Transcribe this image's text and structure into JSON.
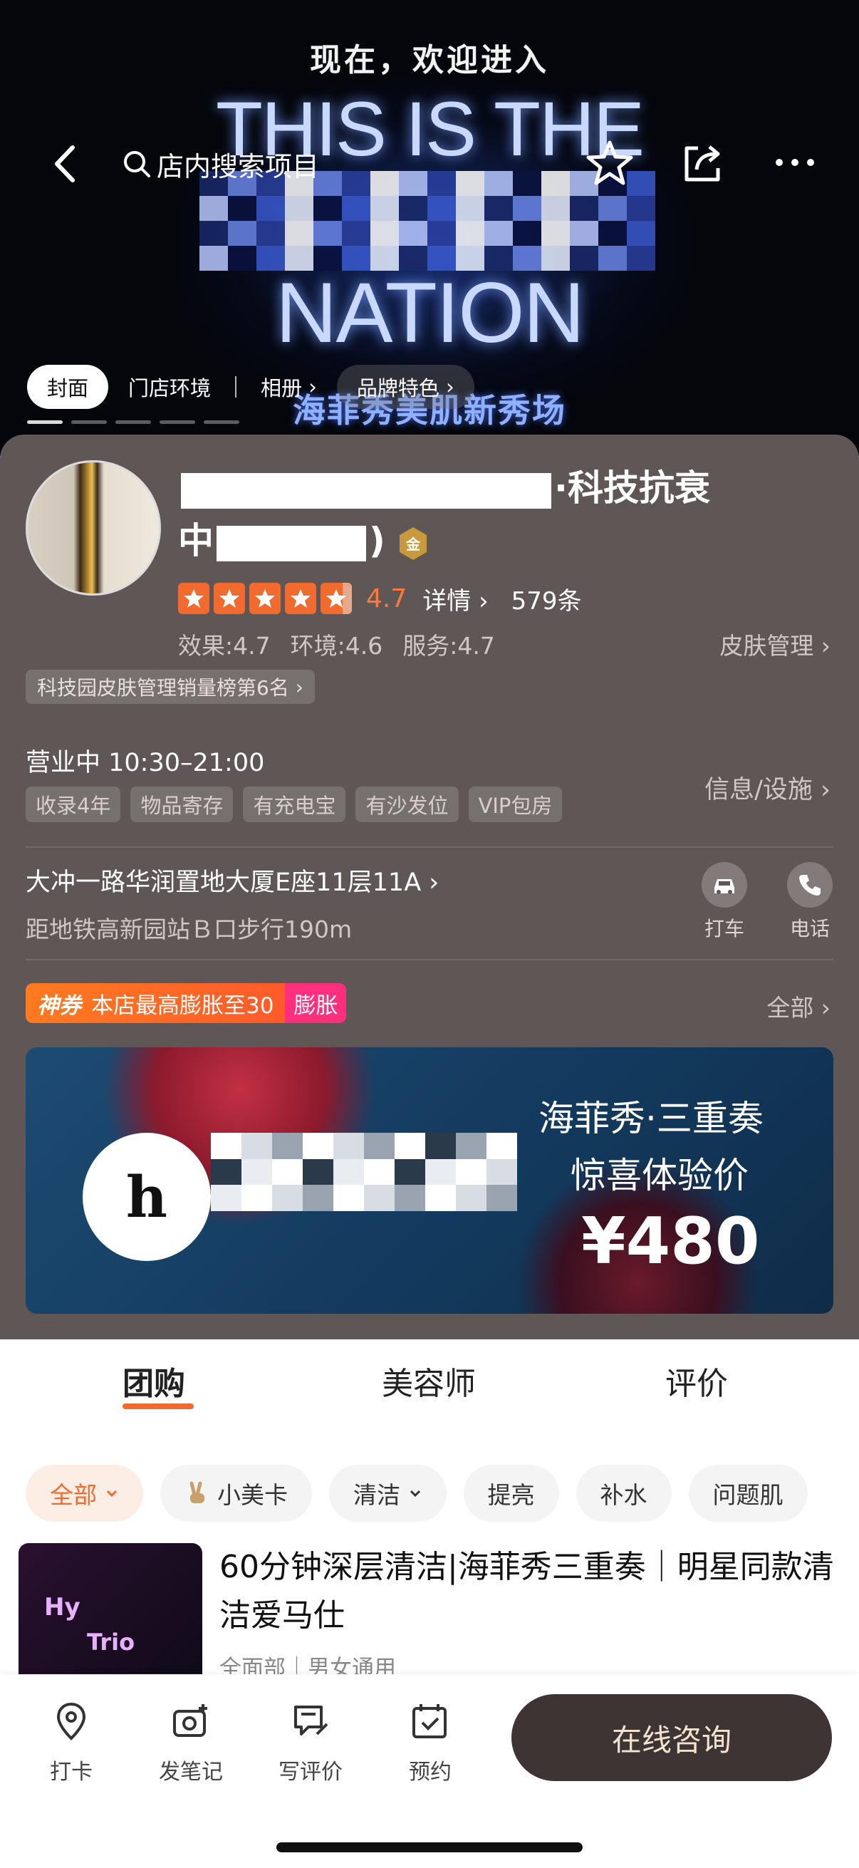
{
  "hero": {
    "sub_title": "现在，欢迎进入",
    "line1": "THIS IS THE",
    "line3": "NATION",
    "caption": "海菲秀美肌新秀场",
    "tabs": [
      "封面",
      "门店环境",
      "相册",
      "品牌特色"
    ]
  },
  "topbar": {
    "search_placeholder": "店内搜索项目"
  },
  "shop": {
    "name_suffix": "·科技抗衰",
    "name_line2_prefix": "中",
    "name_line2_end": ")",
    "badge": "金",
    "score": "4.7",
    "detail_label": "详情",
    "review_count": "579条",
    "sub_scores": [
      "效果:4.7",
      "环境:4.6",
      "服务:4.7"
    ],
    "category_link": "皮肤管理",
    "rank_badge": "科技园皮肤管理销量榜第6名"
  },
  "business": {
    "hours": "营业中 10:30–21:00",
    "tags": [
      "收录4年",
      "物品寄存",
      "有充电宝",
      "有沙发位",
      "VIP包房"
    ],
    "info_link": "信息/设施"
  },
  "location": {
    "address": "大冲一路华润置地大厦E座11层11A",
    "metro": "距地铁高新园站Ｂ口步行190m",
    "actions": [
      "打车",
      "电话"
    ]
  },
  "coupon": {
    "brand": "神券",
    "text": "本店最高膨胀至30",
    "tag": "膨胀",
    "all_link": "全部"
  },
  "promo": {
    "logo_letter": "h",
    "line1": "海菲秀·三重奏",
    "line2": "惊喜体验价",
    "price": "¥480"
  },
  "content_tabs": [
    "团购",
    "美容师",
    "评价"
  ],
  "chips": [
    "全部",
    "小美卡",
    "清洁",
    "提亮",
    "补水",
    "问题肌"
  ],
  "deal": {
    "thumb_line1": "Hy",
    "thumb_line2": "Trio",
    "title": "60分钟深层清洁|海菲秀三重奏｜明星同款清洁爱马仕",
    "meta": "全面部｜男女通用"
  },
  "bottom_bar": {
    "items": [
      "打卡",
      "发笔记",
      "写评价",
      "预约"
    ],
    "consult_label": "在线咨询"
  },
  "colors": {
    "accent": "#f26a2e",
    "card_bg": "#5f5755",
    "coupon_pink": "#ff2f7d",
    "consult_bg": "#3d3433"
  }
}
